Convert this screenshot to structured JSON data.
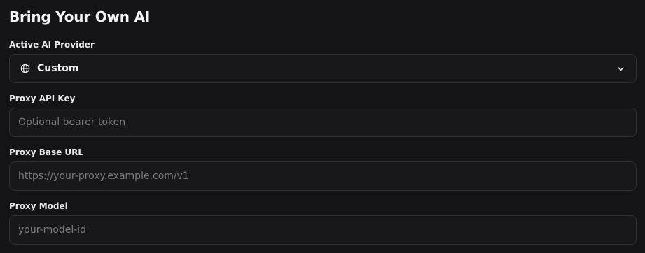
{
  "section": {
    "title": "Bring Your Own AI"
  },
  "provider": {
    "label": "Active AI Provider",
    "selected": "Custom",
    "icon": "globe-icon",
    "dropdown_icon": "chevron-down-icon"
  },
  "api_key": {
    "label": "Proxy API Key",
    "value": "",
    "placeholder": "Optional bearer token"
  },
  "base_url": {
    "label": "Proxy Base URL",
    "value": "",
    "placeholder": "https://your-proxy.example.com/v1"
  },
  "model": {
    "label": "Proxy Model",
    "value": "",
    "placeholder": "your-model-id"
  },
  "colors": {
    "background": "#141416",
    "field_background": "#18181b",
    "field_border": "#2f2f34",
    "text": "#f2f2f3",
    "placeholder": "#7b7b82"
  }
}
